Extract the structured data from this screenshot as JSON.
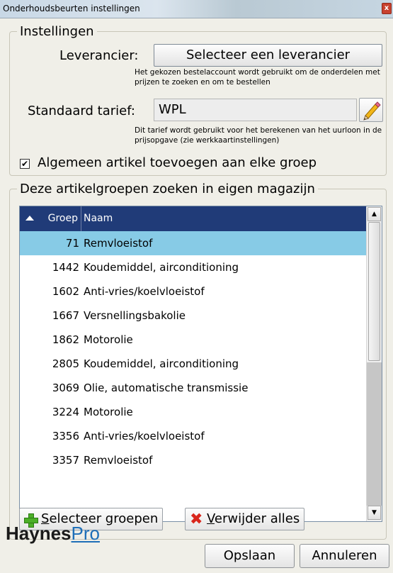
{
  "window": {
    "title": "Onderhoudsbeurten instellingen",
    "close_glyph": "x"
  },
  "instellingen": {
    "legend": "Instellingen",
    "leverancier_label": "Leverancier:",
    "leverancier_button": "Selecteer een leverancier",
    "leverancier_note": "Het gekozen bestelaccount wordt gebruikt om de onderdelen met prijzen te zoeken en om te bestellen",
    "tarief_label": "Standaard tarief:",
    "tarief_value": "WPL",
    "tarief_note": "Dit tarief wordt gebruikt voor het berekenen van het uurloon in de prijsopgave (zie werkkaartinstellingen)",
    "algemeen_checked": true,
    "algemeen_label": "Algemeen artikel toevoegen aan elke groep"
  },
  "artikelgroepen": {
    "legend": "Deze artikelgroepen zoeken in eigen magazijn",
    "columns": {
      "groep": "Groep",
      "naam": "Naam"
    },
    "rows": [
      {
        "groep": "71",
        "naam": "Remvloeistof",
        "selected": true
      },
      {
        "groep": "1442",
        "naam": "Koudemiddel, airconditioning"
      },
      {
        "groep": "1602",
        "naam": "Anti-vries/koelvloeistof"
      },
      {
        "groep": "1667",
        "naam": "Versnellingsbakolie"
      },
      {
        "groep": "1862",
        "naam": "Motorolie"
      },
      {
        "groep": "2805",
        "naam": "Koudemiddel, airconditioning"
      },
      {
        "groep": "3069",
        "naam": "Olie, automatische transmissie"
      },
      {
        "groep": "3224",
        "naam": "Motorolie"
      },
      {
        "groep": "3356",
        "naam": "Anti-vries/koelvloeistof"
      },
      {
        "groep": "3357",
        "naam": "Remvloeistof"
      }
    ],
    "select_button_first": "S",
    "select_button_rest": "electeer groepen",
    "remove_button_first": "V",
    "remove_button_rest": "erwijder alles"
  },
  "footer": {
    "logo_a": "Haynes",
    "logo_b": "Pro",
    "save_label": "Opslaan",
    "cancel_label": "Annuleren"
  },
  "colors": {
    "list_header_bg": "#203b78",
    "selected_row_bg": "#87cbe6",
    "brand_blue": "#1e6fb8"
  }
}
